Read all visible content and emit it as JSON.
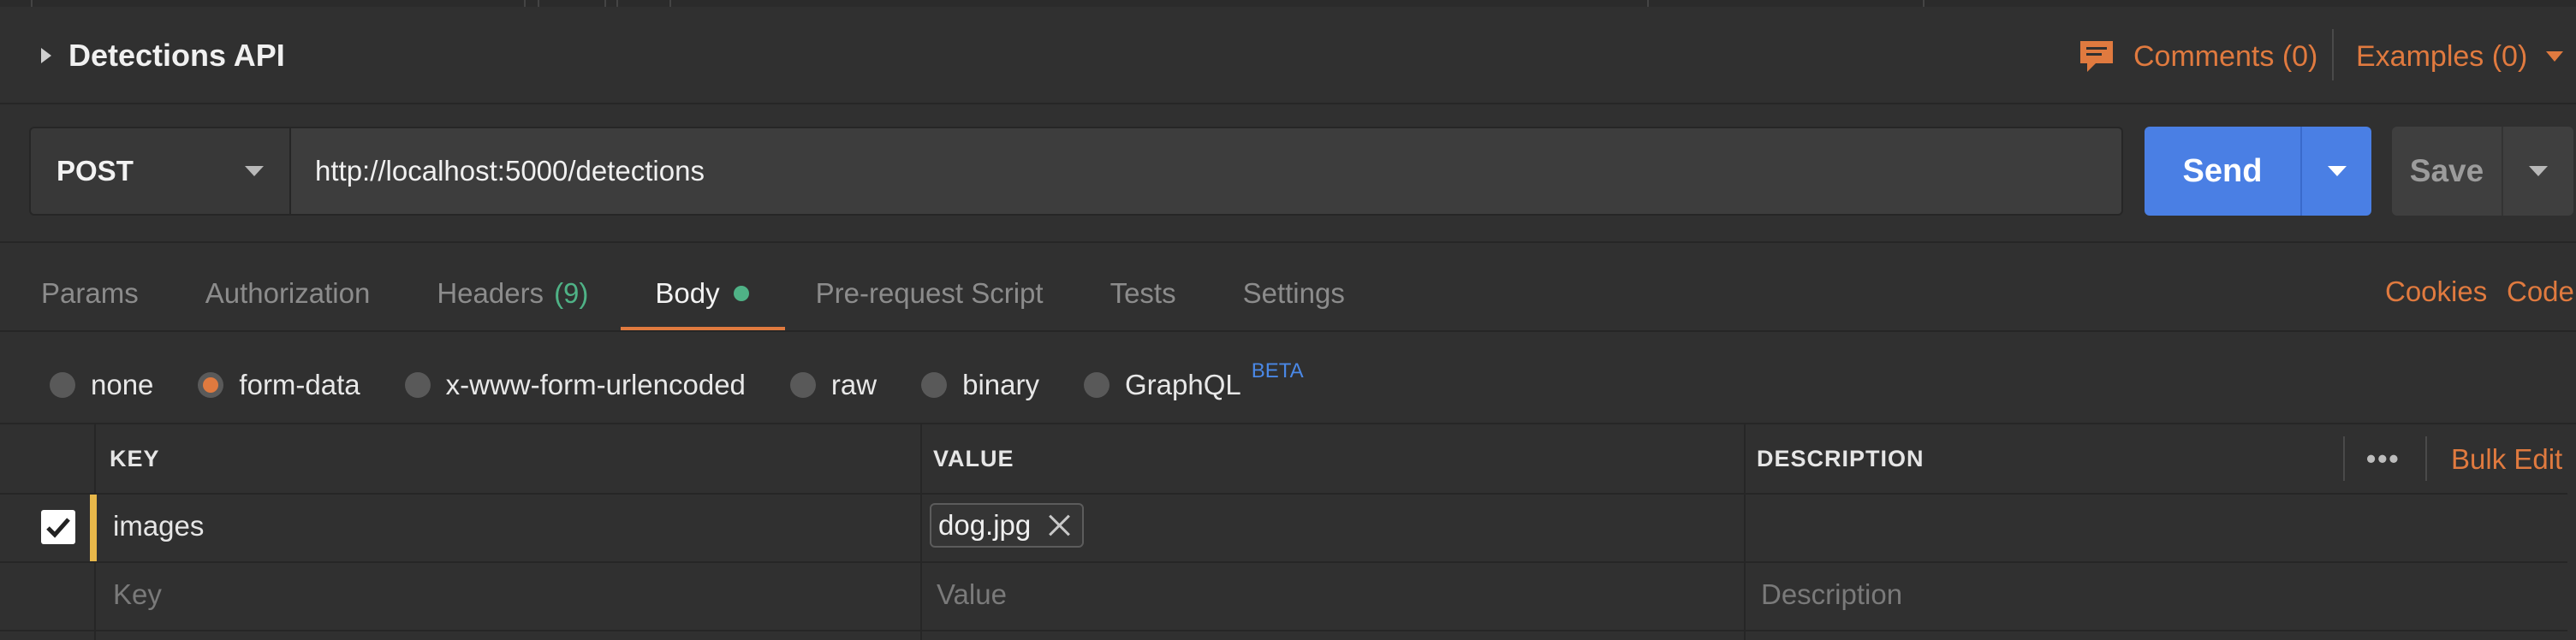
{
  "request": {
    "name": "Detections API",
    "method": "POST",
    "url": "http://localhost:5000/detections"
  },
  "header_actions": {
    "comments": "Comments (0)",
    "examples": "Examples (0)"
  },
  "buttons": {
    "send": "Send",
    "save": "Save"
  },
  "tabs": [
    {
      "label": "Params"
    },
    {
      "label": "Authorization"
    },
    {
      "label": "Headers",
      "count": "(9)"
    },
    {
      "label": "Body"
    },
    {
      "label": "Pre-request Script"
    },
    {
      "label": "Tests"
    },
    {
      "label": "Settings"
    }
  ],
  "active_tab": "Body",
  "right_links": {
    "cookies": "Cookies",
    "code": "Code"
  },
  "body_types": [
    {
      "label": "none",
      "selected": false
    },
    {
      "label": "form-data",
      "selected": true
    },
    {
      "label": "x-www-form-urlencoded",
      "selected": false
    },
    {
      "label": "raw",
      "selected": false
    },
    {
      "label": "binary",
      "selected": false
    },
    {
      "label": "GraphQL",
      "selected": false,
      "badge": "BETA"
    }
  ],
  "table": {
    "columns": [
      "KEY",
      "VALUE",
      "DESCRIPTION"
    ],
    "more_icon": "more-horizontal-icon",
    "bulk_edit": "Bulk Edit",
    "rows": [
      {
        "checked": true,
        "key": "images",
        "value_file": "dog.jpg",
        "description": ""
      }
    ],
    "placeholders": {
      "key": "Key",
      "value": "Value",
      "description": "Description"
    }
  },
  "colors": {
    "accent": "#e07a3f",
    "send_button": "#4a7fe4",
    "count_green": "#4fb286",
    "beta_blue": "#4a88e6",
    "row_marker": "#e8b84a",
    "background": "#303030"
  }
}
